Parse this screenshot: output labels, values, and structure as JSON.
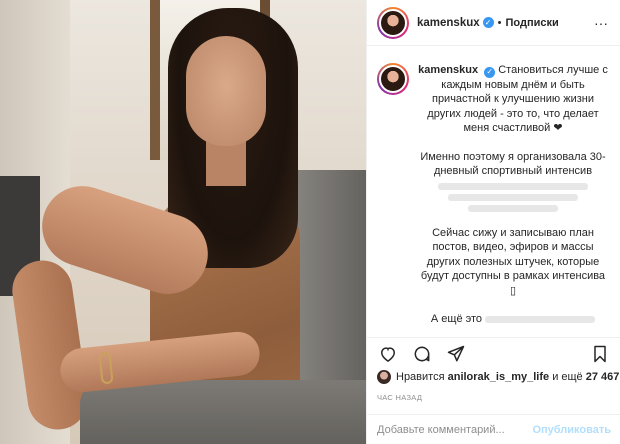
{
  "post": {
    "photo_alt": "",
    "header": {
      "username": "kamenskux",
      "dot": "•",
      "follow_label": "Подписки",
      "more_label": "···"
    },
    "caption": {
      "username": "kamenskux",
      "line1": "Становиться лучше с каждым новым днём и быть причастной к улучшению жизни других людей - это то, что делает меня счастливой ❤",
      "line2": "Именно поэтому я организовала 30-дневный спортивный интенсив",
      "line3": "Сейчас сижу и записываю план постов, видео, эфиров и массы других полезных штучек, которые будут доступны в рамках интенсива ▯",
      "line4": "А ещё это"
    },
    "likes": {
      "prefix": "Нравится",
      "user": "anilorak_is_my_life",
      "middle": "и ещё",
      "count": "27 467"
    },
    "time": "час назад",
    "comment": {
      "placeholder": "Добавьте комментарий...",
      "publish_label": "Опубликовать"
    }
  },
  "colors": {
    "verified": "#3897f0",
    "publish_disabled": "#b2dffc",
    "meta_gray": "#8e8e8e"
  }
}
